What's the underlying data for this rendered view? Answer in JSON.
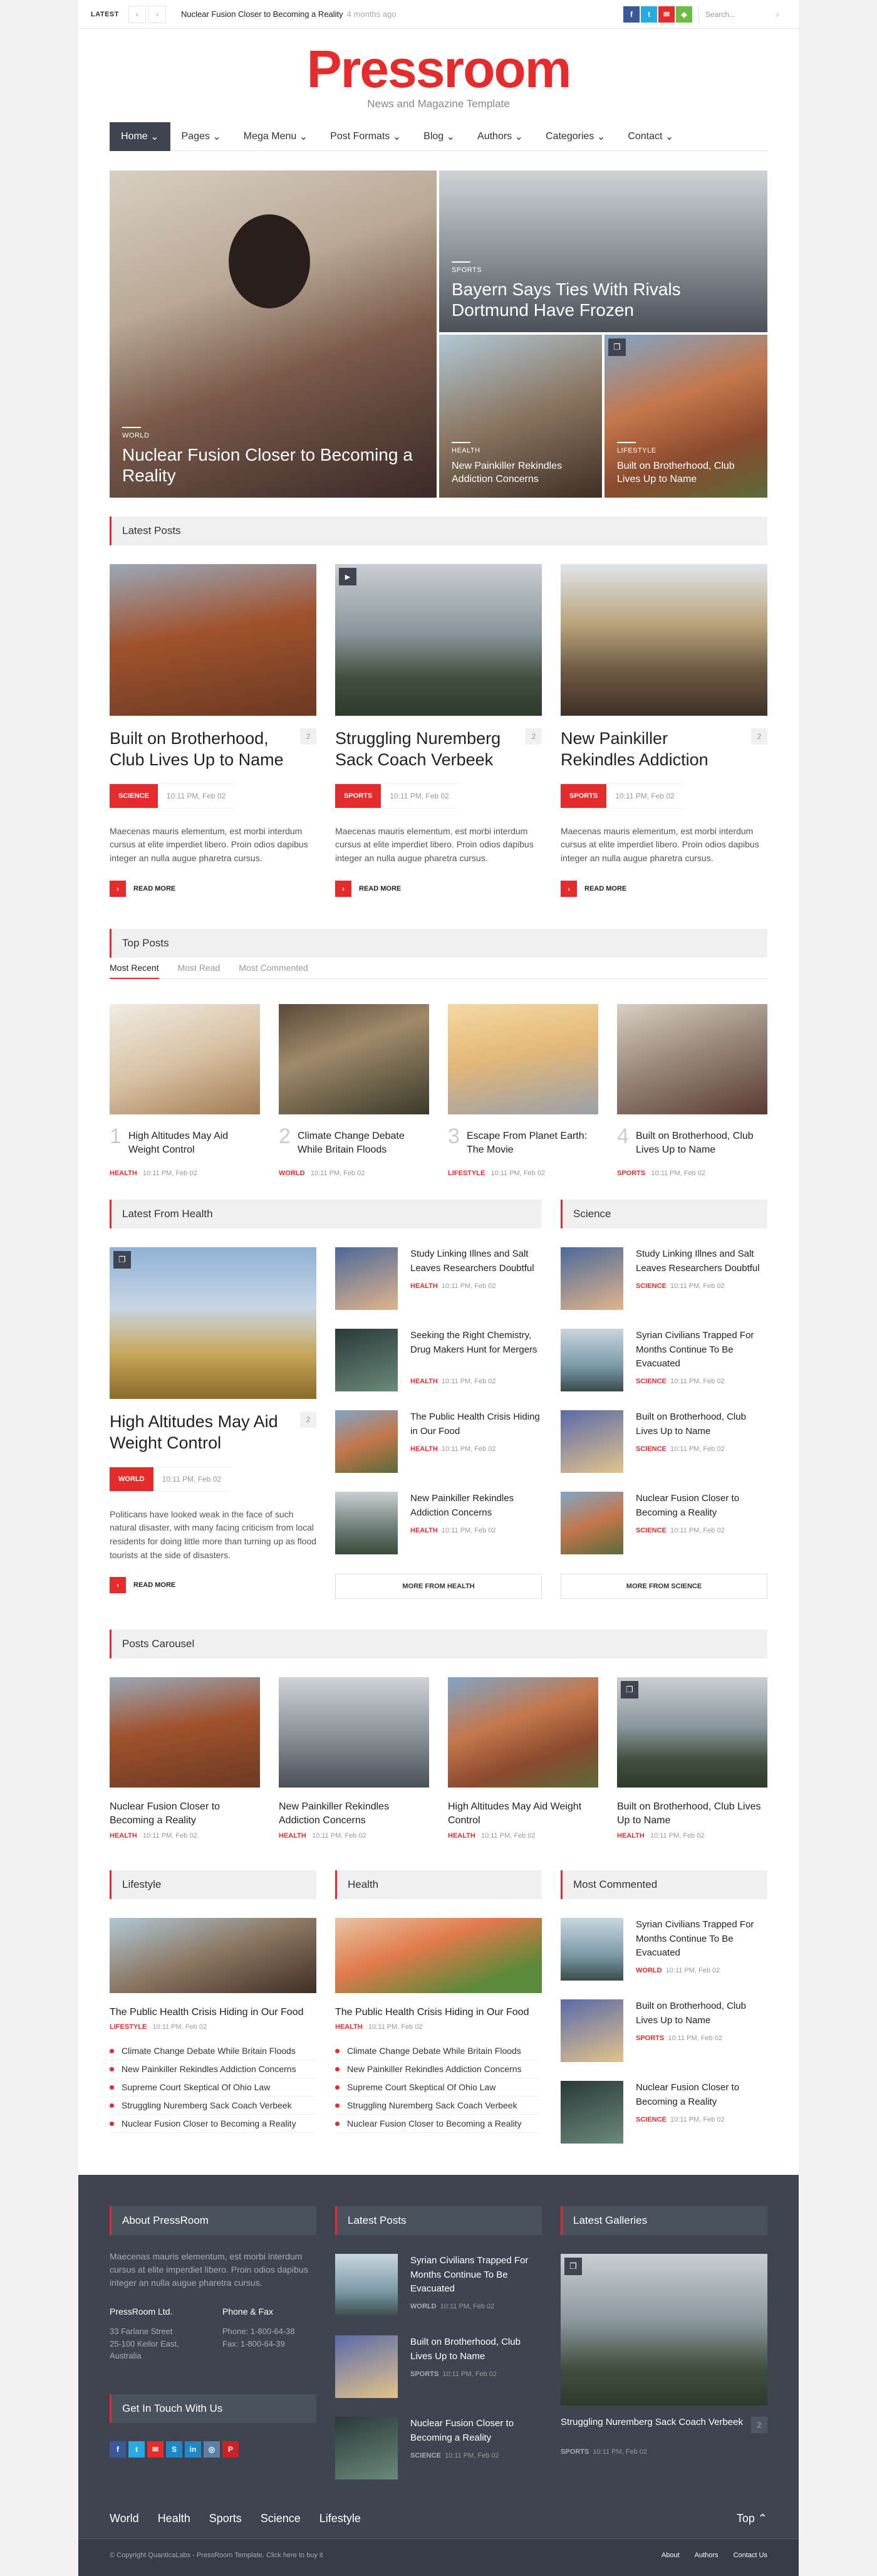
{
  "topbar": {
    "latest": "LATEST",
    "prev": "‹",
    "next": "›",
    "news": "Nuclear Fusion Closer to Becoming a Reality",
    "time": "4 months ago",
    "search": "Search..."
  },
  "social": [
    "f",
    "t",
    "✉",
    "◆"
  ],
  "logo": {
    "title": "Pressroom",
    "subtitle": "News and Magazine Template"
  },
  "nav": [
    "Home",
    "Pages",
    "Mega Menu",
    "Post Formats",
    "Blog",
    "Authors",
    "Categories",
    "Contact"
  ],
  "hero": [
    {
      "cat": "WORLD",
      "title": "Nuclear Fusion Closer to Becoming a Reality"
    },
    {
      "cat": "SPORTS",
      "title": "Bayern Says Ties With Rivals Dortmund Have Frozen"
    },
    {
      "cat": "HEALTH",
      "title": "New Painkiller Rekindles Addiction Concerns"
    },
    {
      "cat": "LIFESTYLE",
      "title": "Built on Brotherhood, Club Lives Up to Name"
    }
  ],
  "latest_posts": {
    "heading": "Latest Posts",
    "posts": [
      {
        "title": "Built on Brotherhood, Club Lives Up to Name",
        "count": "2",
        "cat": "SCIENCE",
        "date": "10:11 PM, Feb 02",
        "excerpt": "Maecenas mauris elementum, est morbi interdum cursus at elite imperdiet libero. Proin odios dapibus integer an nulla augue pharetra cursus.",
        "more": "READ MORE"
      },
      {
        "title": "Struggling Nuremberg Sack Coach Verbeek",
        "count": "2",
        "cat": "SPORTS",
        "date": "10:11 PM, Feb 02",
        "excerpt": "Maecenas mauris elementum, est morbi interdum cursus at elite imperdiet libero. Proin odios dapibus integer an nulla augue pharetra cursus.",
        "more": "READ MORE"
      },
      {
        "title": "New Painkiller Rekindles Addiction",
        "count": "2",
        "cat": "SPORTS",
        "date": "10:11 PM, Feb 02",
        "excerpt": "Maecenas mauris elementum, est morbi interdum cursus at elite imperdiet libero. Proin odios dapibus integer an nulla augue pharetra cursus.",
        "more": "READ MORE"
      }
    ]
  },
  "top_posts": {
    "heading": "Top Posts",
    "tabs": [
      "Most Recent",
      "Most Read",
      "Most Commented"
    ],
    "posts": [
      {
        "num": "1",
        "title": "High Altitudes May Aid Weight Control",
        "cat": "HEALTH",
        "date": "10:11 PM, Feb 02"
      },
      {
        "num": "2",
        "title": "Climate Change Debate While Britain Floods",
        "cat": "WORLD",
        "date": "10:11 PM, Feb 02"
      },
      {
        "num": "3",
        "title": "Escape From Planet Earth: The Movie",
        "cat": "LIFESTYLE",
        "date": "10:11 PM, Feb 02"
      },
      {
        "num": "4",
        "title": "Built on Brotherhood, Club Lives Up to Name",
        "cat": "SPORTS",
        "date": "10:11 PM, Feb 02"
      }
    ]
  },
  "health": {
    "heading": "Latest From Health",
    "main": {
      "title": "High Altitudes May Aid Weight Control",
      "count": "2",
      "cat": "WORLD",
      "date": "10:11 PM, Feb 02",
      "excerpt": "Politicans have looked weak in the face of such natural disaster, with many facing criticism from local residents for doing little more than turning up as flood tourists at the side of disasters.",
      "more": "READ MORE"
    },
    "list": [
      {
        "title": "Study Linking Illnes and Salt Leaves Researchers Doubtful",
        "cat": "HEALTH",
        "date": "10:11 PM, Feb 02"
      },
      {
        "title": "Seeking the Right Chemistry, Drug Makers Hunt for Mergers",
        "cat": "HEALTH",
        "date": "10:11 PM, Feb 02"
      },
      {
        "title": "The Public Health Crisis Hiding in Our Food",
        "cat": "HEALTH",
        "date": "10:11 PM, Feb 02"
      },
      {
        "title": "New Painkiller Rekindles Addiction Concerns",
        "cat": "HEALTH",
        "date": "10:11 PM, Feb 02"
      }
    ],
    "more": "MORE FROM HEALTH"
  },
  "science": {
    "heading": "Science",
    "list": [
      {
        "title": "Study Linking Illnes and Salt Leaves Researchers Doubtful",
        "cat": "SCIENCE",
        "date": "10:11 PM, Feb 02"
      },
      {
        "title": "Syrian Civilians Trapped For Months Continue To Be Evacuated",
        "cat": "SCIENCE",
        "date": "10:11 PM, Feb 02"
      },
      {
        "title": "Built on Brotherhood, Club Lives Up to Name",
        "cat": "SCIENCE",
        "date": "10:11 PM, Feb 02"
      },
      {
        "title": "Nuclear Fusion Closer to Becoming a Reality",
        "cat": "SCIENCE",
        "date": "10:11 PM, Feb 02"
      }
    ],
    "more": "MORE FROM SCIENCE"
  },
  "carousel": {
    "heading": "Posts Carousel",
    "posts": [
      {
        "title": "Nuclear Fusion Closer to Becoming a Reality",
        "cat": "HEALTH",
        "date": "10:11 PM, Feb 02"
      },
      {
        "title": "New Painkiller Rekindles Addiction Concerns",
        "cat": "HEALTH",
        "date": "10:11 PM, Feb 02"
      },
      {
        "title": "High Altitudes May Aid Weight Control",
        "cat": "HEALTH",
        "date": "10:11 PM, Feb 02"
      },
      {
        "title": "Built on Brotherhood, Club Lives Up to Name",
        "cat": "HEALTH",
        "date": "10:11 PM, Feb 02"
      }
    ]
  },
  "lifestyle": {
    "heading": "Lifestyle",
    "title": "The Public Health Crisis Hiding in Our Food",
    "cat": "LIFESTYLE",
    "date": "10:11 PM, Feb 02",
    "list": [
      "Climate Change Debate While Britain Floods",
      "New Painkiller Rekindles Addiction Concerns",
      "Supreme Court Skeptical Of Ohio Law",
      "Struggling Nuremberg Sack Coach Verbeek",
      "Nuclear Fusion Closer to Becoming a Reality"
    ]
  },
  "health2": {
    "heading": "Health",
    "title": "The Public Health Crisis Hiding in Our Food",
    "cat": "HEALTH",
    "date": "10:11 PM, Feb 02",
    "list": [
      "Climate Change Debate While Britain Floods",
      "New Painkiller Rekindles Addiction Concerns",
      "Supreme Court Skeptical Of Ohio Law",
      "Struggling Nuremberg Sack Coach Verbeek",
      "Nuclear Fusion Closer to Becoming a Reality"
    ]
  },
  "most_commented": {
    "heading": "Most Commented",
    "list": [
      {
        "title": "Syrian Civilians Trapped For Months Continue To Be Evacuated",
        "cat": "WORLD",
        "date": "10:11 PM, Feb 02"
      },
      {
        "title": "Built on Brotherhood, Club Lives Up to Name",
        "cat": "SPORTS",
        "date": "10:11 PM, Feb 02"
      },
      {
        "title": "Nuclear Fusion Closer to Becoming a Reality",
        "cat": "SCIENCE",
        "date": "10:11 PM, Feb 02"
      }
    ]
  },
  "footer": {
    "about_h": "About PressRoom",
    "about": "Maecenas mauris elementum, est morbi interdum cursus at elite imperdiet libero. Proin odios dapibus integer an nulla augue pharetra cursus.",
    "company": "PressRoom Ltd.",
    "address": "33 Farlane Street\n25-100 Keilor East,\nAustralia",
    "phone_h": "Phone & Fax",
    "phone": "Phone: 1-800-64-38",
    "fax": "Fax: 1-800-64-39",
    "touch_h": "Get In Touch With Us",
    "latest_h": "Latest Posts",
    "latest": [
      {
        "title": "Syrian Civilians Trapped For Months Continue To Be Evacuated",
        "cat": "WORLD",
        "date": "10:11 PM, Feb 02"
      },
      {
        "title": "Built on Brotherhood, Club Lives Up to Name",
        "cat": "SPORTS",
        "date": "10:11 PM, Feb 02"
      },
      {
        "title": "Nuclear Fusion Closer to Becoming a Reality",
        "cat": "SCIENCE",
        "date": "10:11 PM, Feb 02"
      }
    ],
    "gal_h": "Latest Galleries",
    "gal_title": "Struggling Nuremberg Sack Coach Verbeek",
    "gal_count": "2",
    "gal_cat": "SPORTS",
    "gal_date": "10:11 PM, Feb 02",
    "links": [
      "World",
      "Health",
      "Sports",
      "Science",
      "Lifestyle"
    ],
    "top": "Top ⌃",
    "copyright": "© Copyright QuanticaLabs - PressRoom Template. Click here to buy it",
    "bottom_links": [
      "About",
      "Authors",
      "Contact Us"
    ]
  },
  "colors": {
    "accent": "#e52c2c",
    "dark": "#3e4551"
  }
}
